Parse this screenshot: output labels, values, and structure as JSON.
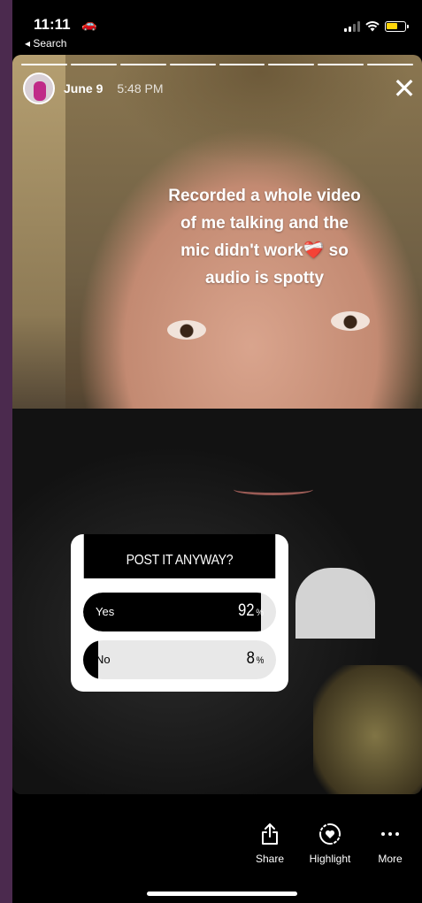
{
  "status_bar": {
    "time": "11:11",
    "back_label": "◂ Search"
  },
  "story": {
    "date": "June 9",
    "time": "5:48 PM",
    "caption_lines": [
      "Recorded a whole video",
      "of me talking and the",
      "mic didn't work",
      " so",
      "audio is spotty"
    ],
    "caption_emoji": "❤️‍🩹"
  },
  "poll": {
    "question": "POST IT ANYWAY?",
    "options": [
      {
        "label": "Yes",
        "percent": 92,
        "percent_text": "92"
      },
      {
        "label": "No",
        "percent": 8,
        "percent_text": "8"
      }
    ],
    "percent_sign": "%"
  },
  "actions": {
    "share": "Share",
    "highlight": "Highlight",
    "more": "More"
  }
}
